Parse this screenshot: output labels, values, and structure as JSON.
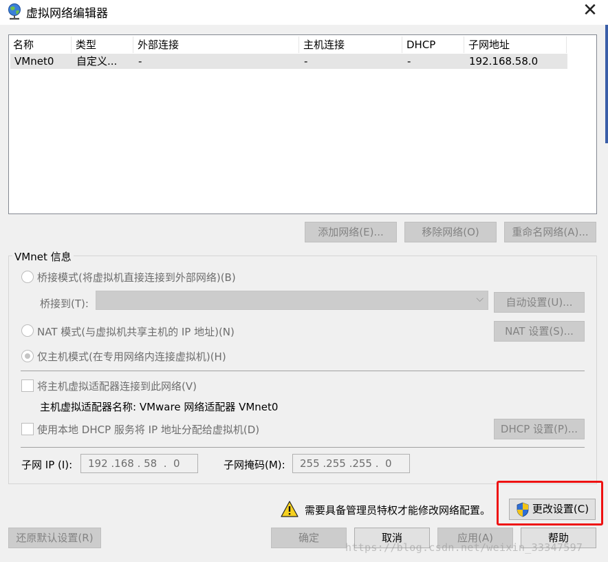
{
  "window": {
    "title": "虚拟网络编辑器",
    "close_glyph": "✕"
  },
  "network_list": {
    "headers": [
      "名称",
      "类型",
      "外部连接",
      "主机连接",
      "DHCP",
      "子网地址"
    ],
    "rows": [
      {
        "name": "VMnet0",
        "type": "自定义...",
        "external": "-",
        "host": "-",
        "dhcp": "-",
        "subnet": "192.168.58.0"
      }
    ]
  },
  "list_buttons": {
    "add": "添加网络(E)...",
    "remove": "移除网络(O)",
    "rename": "重命名网络(A)..."
  },
  "vmnet_info": {
    "legend": "VMnet 信息",
    "bridged_label": "桥接模式(将虚拟机直接连接到外部网络)(B)",
    "bridge_to_label": "桥接到(T):",
    "bridge_to_value": "",
    "auto_settings": "自动设置(U)...",
    "nat_label": "NAT 模式(与虚拟机共享主机的 IP 地址)(N)",
    "nat_settings": "NAT 设置(S)...",
    "host_only_label": "仅主机模式(在专用网络内连接虚拟机)(H)",
    "mode_selected": "host-only",
    "connect_adapter_label": "将主机虚拟适配器连接到此网络(V)",
    "connect_adapter_checked": false,
    "adapter_name_text": "主机虚拟适配器名称: VMware 网络适配器 VMnet0",
    "dhcp_label": "使用本地 DHCP 服务将 IP 地址分配给虚拟机(D)",
    "dhcp_checked": false,
    "dhcp_settings": "DHCP 设置(P)...",
    "subnet_ip_label": "子网 IP (I):",
    "subnet_ip_value": "192 .168 . 58  .  0",
    "subnet_mask_label": "子网掩码(M):",
    "subnet_mask_value": "255 .255 .255 .  0"
  },
  "admin": {
    "warning_text": "需要具备管理员特权才能修改网络配置。",
    "change_settings": "更改设置(C)"
  },
  "footer": {
    "restore_defaults": "还原默认设置(R)",
    "ok": "确定",
    "cancel": "取消",
    "apply": "应用(A)",
    "help": "帮助"
  },
  "watermark": "https://blog.csdn.net/weixin_33347597",
  "colors": {
    "highlight_box": "#ee1111",
    "window_bg": "#f0f0f0",
    "selected_row": "#e5e5e5"
  }
}
